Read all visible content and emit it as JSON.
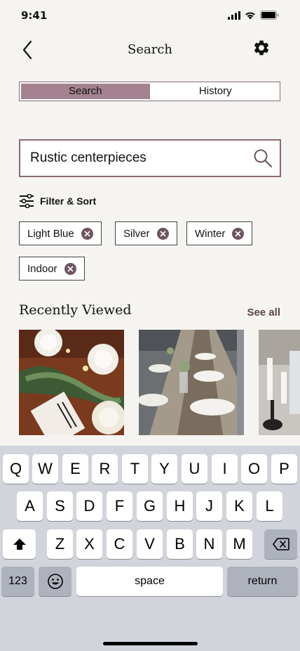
{
  "status": {
    "time": "9:41"
  },
  "header": {
    "title": "Search"
  },
  "tabs": [
    {
      "label": "Search",
      "active": true
    },
    {
      "label": "History",
      "active": false
    }
  ],
  "search": {
    "value": "Rustic centerpieces",
    "placeholder": ""
  },
  "filter": {
    "label": "Filter & Sort"
  },
  "chips": [
    "Light Blue",
    "Silver",
    "Winter",
    "Indoor"
  ],
  "recent": {
    "title": "Recently Viewed",
    "see_all": "See all"
  },
  "keyboard": {
    "row1": [
      "Q",
      "W",
      "E",
      "R",
      "T",
      "Y",
      "U",
      "I",
      "O",
      "P"
    ],
    "row2": [
      "A",
      "S",
      "D",
      "F",
      "G",
      "H",
      "J",
      "K",
      "L"
    ],
    "row3": [
      "Z",
      "X",
      "C",
      "V",
      "B",
      "N",
      "M"
    ],
    "numbers": "123",
    "space": "space",
    "return": "return"
  },
  "colors": {
    "accent": "#a48290",
    "accent_dark": "#6e5561",
    "border": "#8a6a77",
    "background": "#f5f4f1",
    "keyboard": "#d2d4dc"
  },
  "icons": [
    "back-chevron-icon",
    "gear-icon",
    "search-icon",
    "filter-sliders-icon",
    "close-circle-icon",
    "shift-icon",
    "backspace-icon",
    "emoji-icon"
  ]
}
